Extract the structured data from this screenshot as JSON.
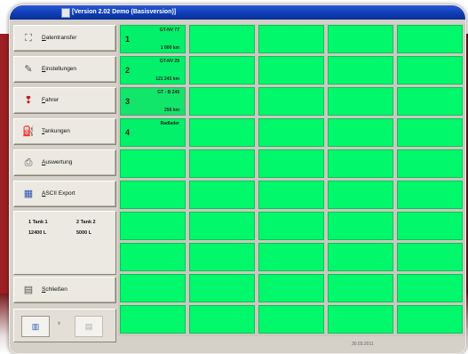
{
  "window": {
    "title": "[Version 2.02 Demo (Basisversion)]"
  },
  "nav": [
    {
      "label": "Datentransfer",
      "icon": "satellite-dish-icon",
      "glyph": "⛶"
    },
    {
      "label": "Einstellungen",
      "icon": "pencil-icon",
      "glyph": "✎"
    },
    {
      "label": "Fahrer",
      "icon": "fahrer-icon",
      "glyph": "❢"
    },
    {
      "label": "Tankungen",
      "icon": "fuel-pump-icon",
      "glyph": "⛽"
    },
    {
      "label": "Auswertung",
      "icon": "printer-icon",
      "glyph": "⎙"
    },
    {
      "label": "ASCII Export",
      "icon": "ascii-icon",
      "glyph": "▦"
    }
  ],
  "tanks": {
    "tank1_label": "1 Tank 1",
    "tank1_value": "12400 L",
    "tank2_label": "2 Tank 2",
    "tank2_value": "5000 L"
  },
  "close_button": {
    "label": "Schließen",
    "icon": "close-door-icon",
    "glyph": "▤"
  },
  "bottom": {
    "left_icon": "table-icon",
    "left_glyph": "▥",
    "separator": "x",
    "right_icon": "list-icon",
    "right_glyph": "▤"
  },
  "vehicles": [
    {
      "number": "1",
      "name": "GT-NV 77",
      "km": "1 000 km"
    },
    {
      "number": "2",
      "name": "GT-NV 29",
      "km": "121 245 km"
    },
    {
      "number": "3",
      "name": "GT - B 249",
      "km": "256 km"
    },
    {
      "number": "4",
      "name": "Radlader",
      "km": ""
    }
  ],
  "status": {
    "date": "30.03.2011"
  },
  "colors": {
    "cell_green": "#00f86a",
    "titlebar_blue": "#0f3db8"
  }
}
